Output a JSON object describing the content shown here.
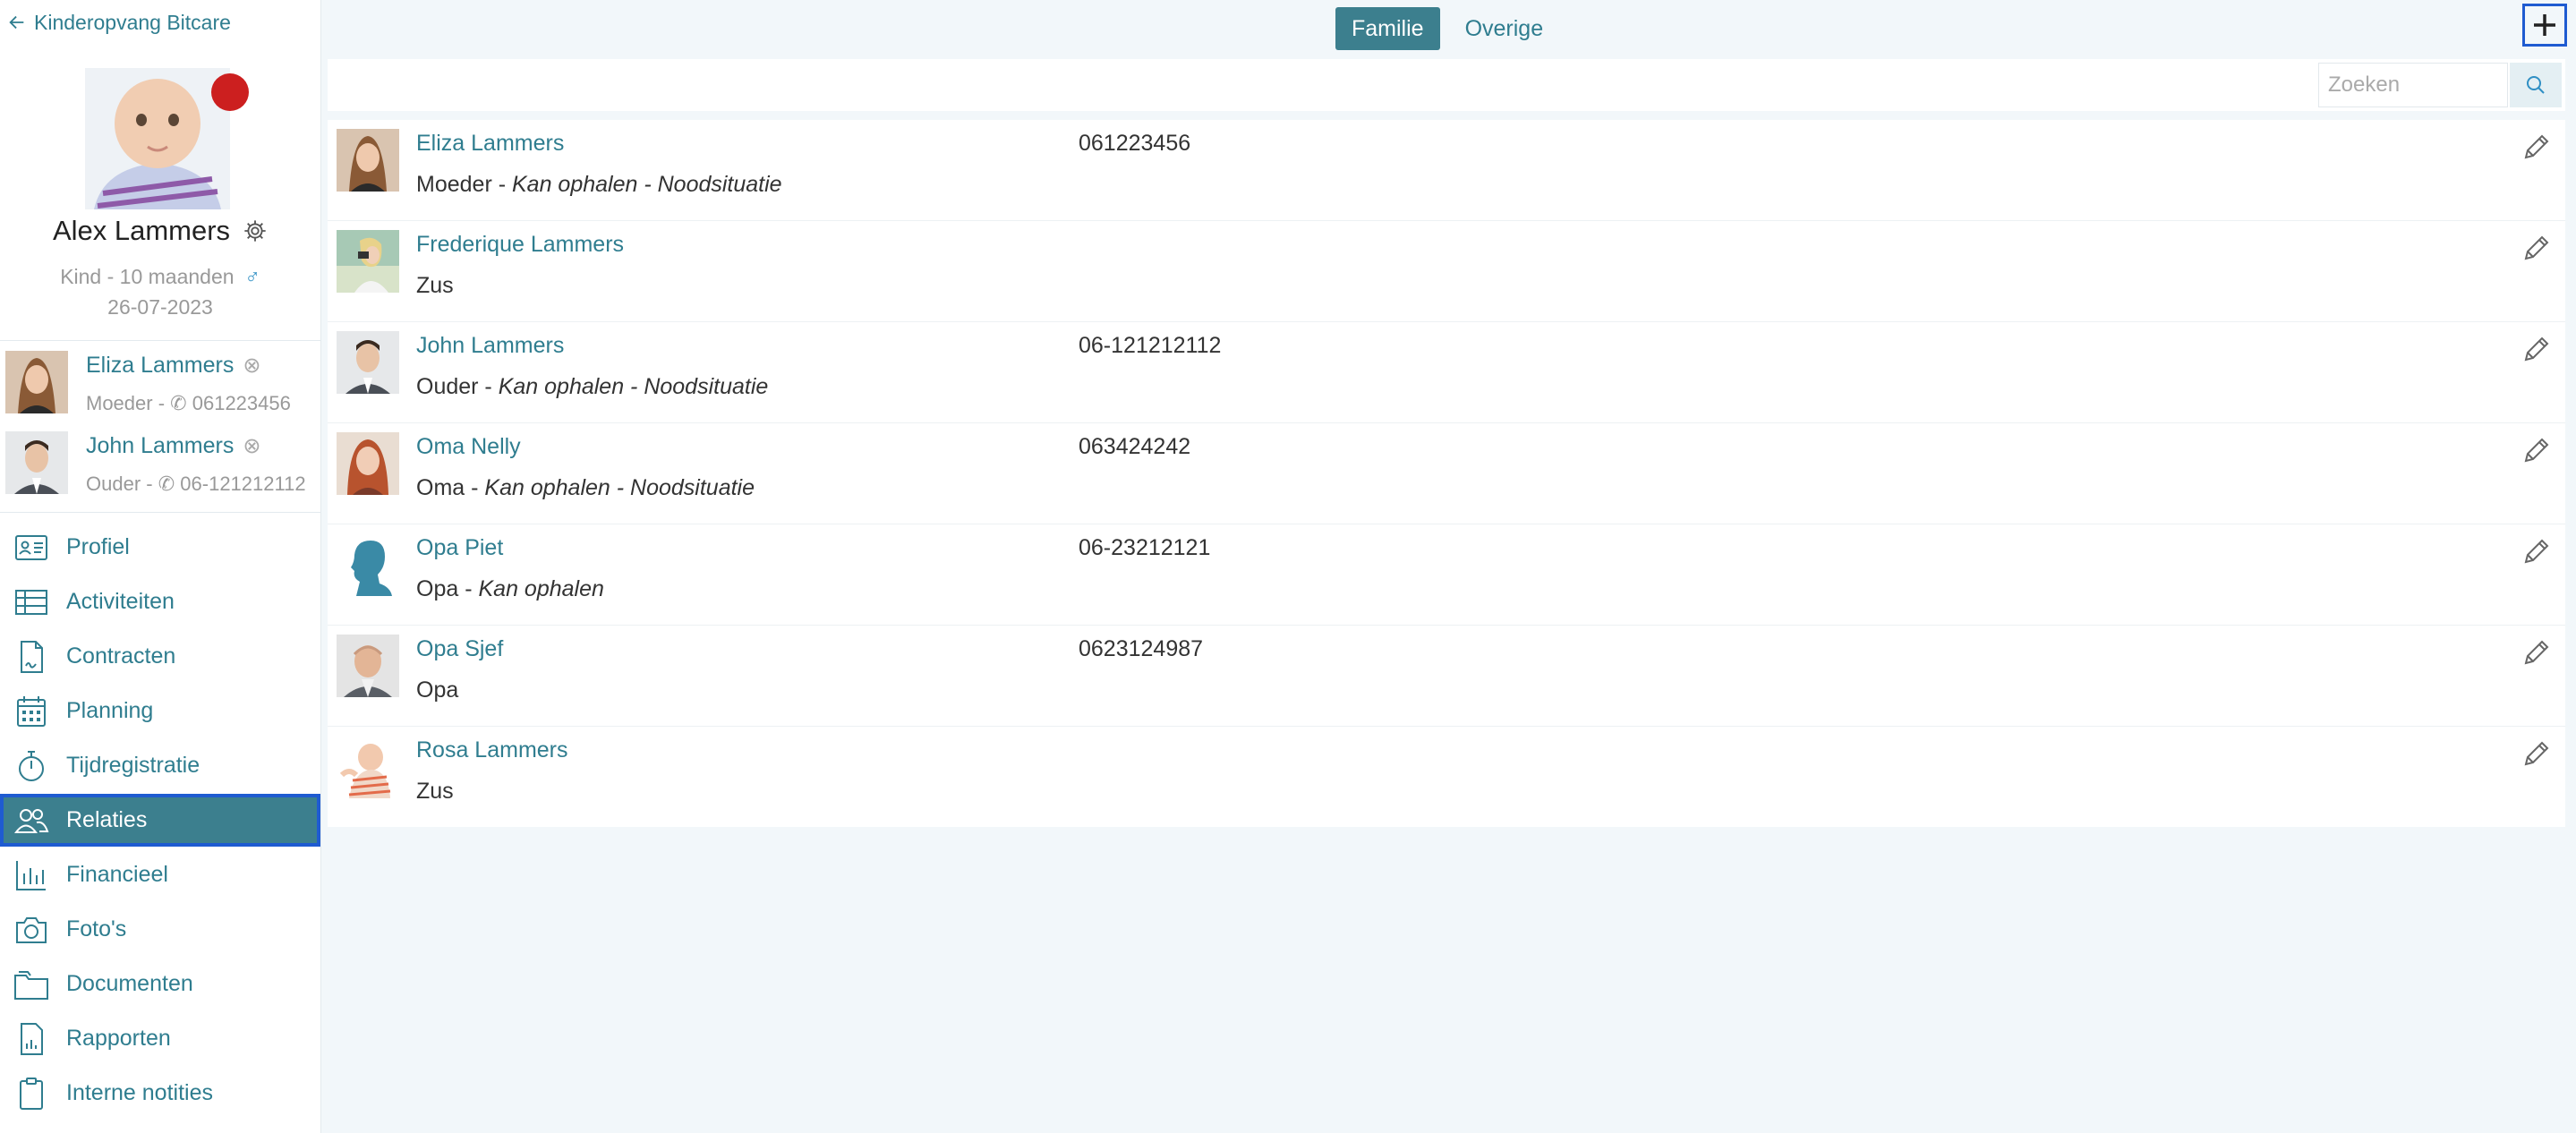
{
  "sidebar": {
    "back_label": "Kinderopvang Bitcare",
    "child": {
      "name": "Alex Lammers",
      "meta": "Kind - 10 maanden",
      "gender_symbol": "♂",
      "birthdate": "26-07-2023",
      "status_color": "#cc1f1f"
    },
    "contacts": [
      {
        "name": "Eliza Lammers",
        "role": "Moeder -",
        "phone": "061223456",
        "remove_symbol": "⊗"
      },
      {
        "name": "John Lammers",
        "role": "Ouder -",
        "phone": "06-121212112",
        "remove_symbol": "⊗"
      }
    ],
    "nav": [
      {
        "label": "Profiel",
        "icon": "id-card-icon"
      },
      {
        "label": "Activiteiten",
        "icon": "table-icon"
      },
      {
        "label": "Contracten",
        "icon": "contract-icon"
      },
      {
        "label": "Planning",
        "icon": "calendar-icon"
      },
      {
        "label": "Tijdregistratie",
        "icon": "stopwatch-icon"
      },
      {
        "label": "Relaties",
        "icon": "people-icon",
        "active": true
      },
      {
        "label": "Financieel",
        "icon": "bar-chart-icon"
      },
      {
        "label": "Foto's",
        "icon": "camera-icon"
      },
      {
        "label": "Documenten",
        "icon": "folder-icon"
      },
      {
        "label": "Rapporten",
        "icon": "report-icon"
      },
      {
        "label": "Interne notities",
        "icon": "clipboard-icon"
      }
    ]
  },
  "tabs": {
    "familie": "Familie",
    "overige": "Overige",
    "active": "Familie"
  },
  "search": {
    "placeholder": "Zoeken",
    "value": ""
  },
  "relations": [
    {
      "name": "Eliza Lammers",
      "relation": "Moeder",
      "separator": " - ",
      "permissions": "Kan ophalen - Noodsituatie",
      "phone": "061223456",
      "avatar": "woman-photo"
    },
    {
      "name": "Frederique Lammers",
      "relation": "Zus",
      "separator": "",
      "permissions": "",
      "phone": "",
      "avatar": "girl-camera-photo"
    },
    {
      "name": "John Lammers",
      "relation": "Ouder",
      "separator": " - ",
      "permissions": "Kan ophalen - Noodsituatie",
      "phone": "06-121212112",
      "avatar": "man-photo"
    },
    {
      "name": "Oma Nelly",
      "relation": "Oma",
      "separator": " - ",
      "permissions": "Kan ophalen - Noodsituatie",
      "phone": "063424242",
      "avatar": "red-hair-woman-photo"
    },
    {
      "name": "Opa Piet",
      "relation": "Opa",
      "separator": " - ",
      "permissions": "Kan ophalen",
      "phone": "06-23212121",
      "avatar": "silhouette-icon"
    },
    {
      "name": "Opa Sjef",
      "relation": "Opa",
      "separator": "",
      "permissions": "",
      "phone": "0623124987",
      "avatar": "bald-man-photo"
    },
    {
      "name": "Rosa Lammers",
      "relation": "Zus",
      "separator": "",
      "permissions": "",
      "phone": "",
      "avatar": "baby-photo"
    }
  ],
  "colors": {
    "accent": "#3c7f8e",
    "link": "#2f7d8f",
    "highlight_border": "#1f5bd1",
    "background": "#f2f7fa"
  }
}
